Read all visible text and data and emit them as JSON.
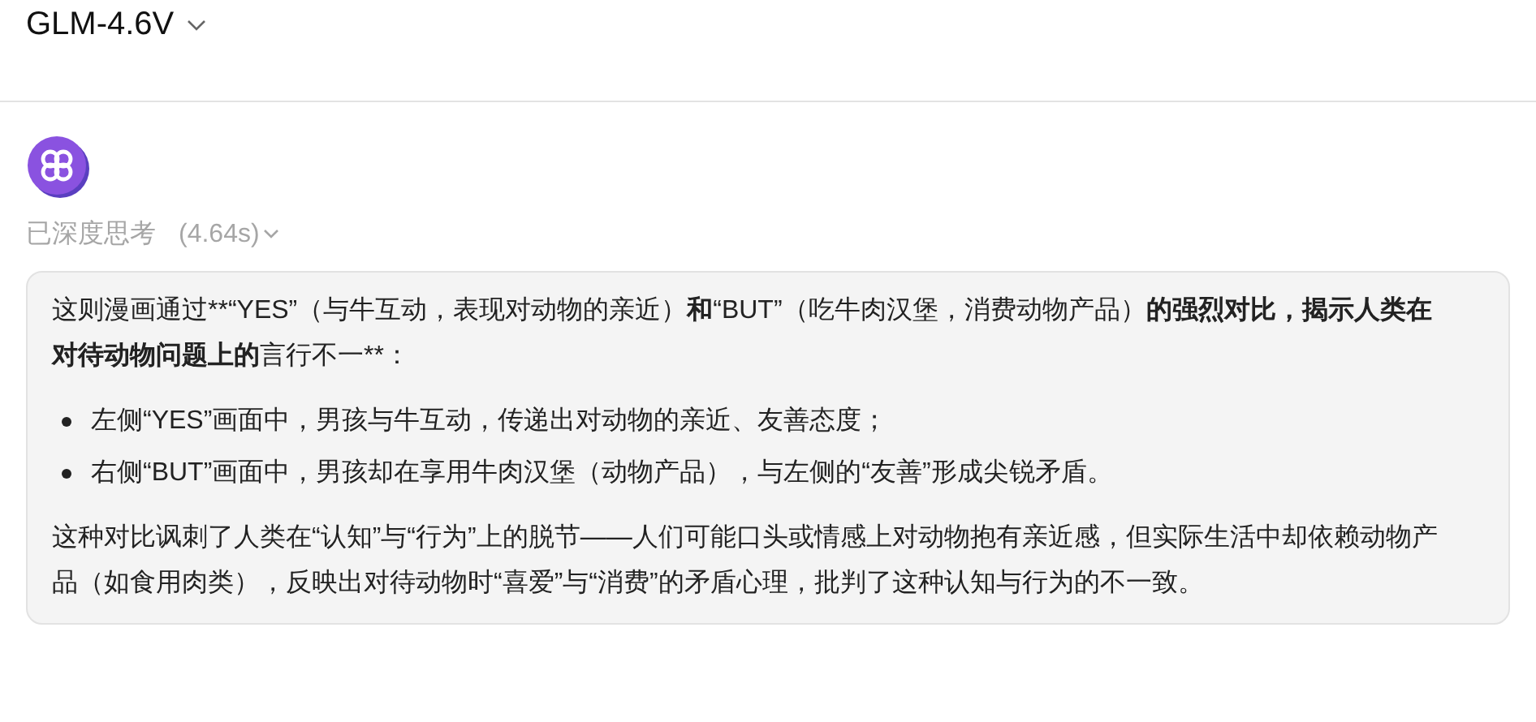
{
  "header": {
    "model": "GLM-4.6V"
  },
  "message": {
    "thinking": {
      "label": "已深度思考",
      "duration": "(4.64s)",
      "expanded": false
    },
    "intro": [
      {
        "text": "这则漫画通过**“YES”（与牛互动，表现对动物的亲近）",
        "bold": false
      },
      {
        "text": "和",
        "bold": true
      },
      {
        "text": "“BUT”（吃牛肉汉堡，消费动物产品）",
        "bold": false
      },
      {
        "text": "的强烈对比，揭示人类在对待动物问题上的",
        "bold": true
      },
      {
        "text": "言行不一**：",
        "bold": false
      }
    ],
    "bullets": [
      "左侧“YES”画面中，男孩与牛互动，传递出对动物的亲近、友善态度；",
      "右侧“BUT”画面中，男孩却在享用牛肉汉堡（动物产品），与左侧的“友善”形成尖锐矛盾。"
    ],
    "conclusion": "这种对比讽刺了人类在“认知”与“行为”上的脱节——人们可能口头或情感上对动物抱有亲近感，但实际生活中却依赖动物产品（如食用肉类），反映出对待动物时“喜爱”与“消费”的矛盾心理，批判了这种认知与行为的不一致。"
  }
}
